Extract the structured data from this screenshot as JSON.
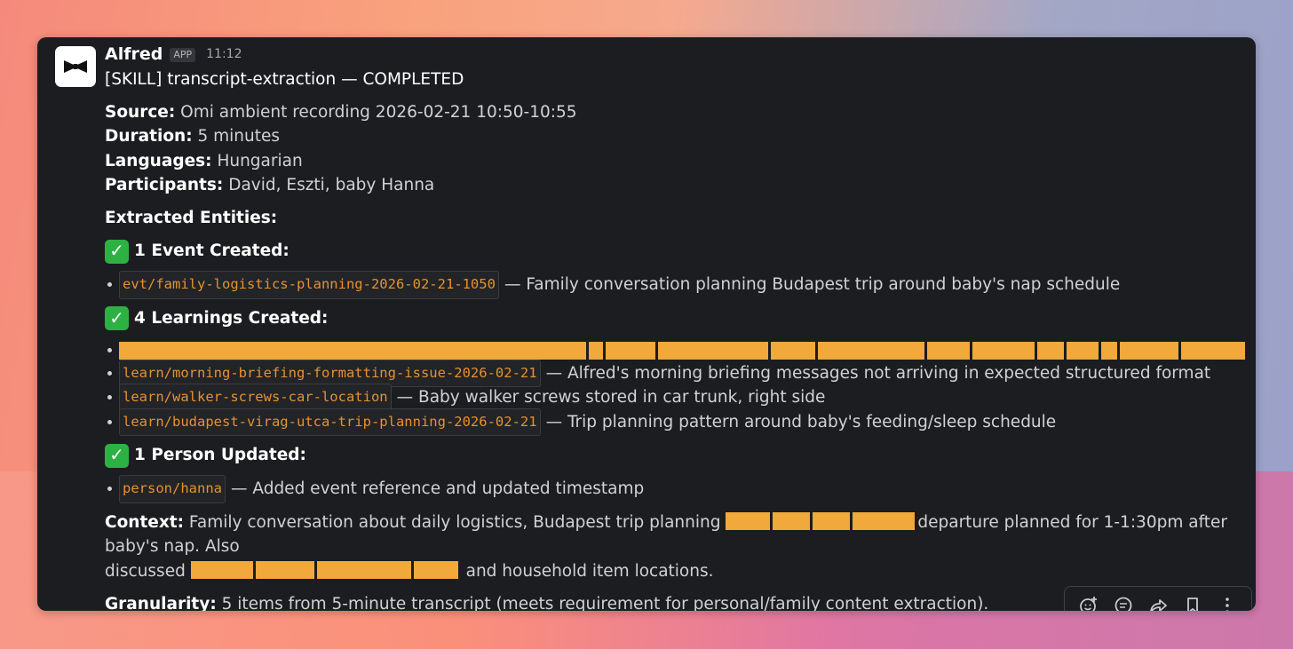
{
  "message": {
    "sender": "Alfred",
    "app_badge": "APP",
    "time": "11:12",
    "title": "[SKILL] transcript-extraction — COMPLETED"
  },
  "meta": [
    {
      "label": "Source:",
      "value": "Omi ambient recording 2026-02-21 10:50-10:55"
    },
    {
      "label": "Duration:",
      "value": "5 minutes"
    },
    {
      "label": "Languages:",
      "value": "Hungarian"
    },
    {
      "label": "Participants:",
      "value": "David, Eszti, baby Hanna"
    }
  ],
  "extracted_label": "Extracted Entities:",
  "sections": {
    "events": {
      "heading": "1 Event Created:",
      "items": [
        {
          "code": "evt/family-logistics-planning-2026-02-21-1050",
          "text": "— Family conversation planning Budapest trip around baby's nap schedule"
        }
      ]
    },
    "learnings": {
      "heading": "4 Learnings Created:",
      "items": [
        {
          "code": "learn/morning-briefing-formatting-issue-2026-02-21",
          "text": "— Alfred's morning briefing messages not arriving in expected structured format"
        },
        {
          "code": "learn/walker-screws-car-location",
          "text": "— Baby walker screws stored in car trunk, right side"
        },
        {
          "code": "learn/budapest-virag-utca-trip-planning-2026-02-21",
          "text": "— Trip planning pattern around baby's feeding/sleep schedule"
        }
      ]
    },
    "persons": {
      "heading": "1 Person Updated:",
      "items": [
        {
          "code": "person/hanna",
          "text": "— Added event reference and updated timestamp"
        }
      ]
    }
  },
  "context": {
    "label": "Context:",
    "part1": "Family conversation about daily logistics, Budapest trip planning",
    "part2": "departure planned for 1-1:30pm after baby's nap. Also",
    "part3": "discussed",
    "part4": "and household item locations."
  },
  "granularity": {
    "label": "Granularity:",
    "value": "5 items from 5-minute transcript (meets requirement for personal/family content extraction)."
  },
  "colors": {
    "window_bg": "#1b1d21",
    "code_text": "#e8912d",
    "redaction": "#f0a93a",
    "check_green": "#2db143"
  },
  "icons": [
    "add-reaction-icon",
    "reply-thread-icon",
    "share-icon",
    "bookmark-icon",
    "more-actions-icon"
  ]
}
